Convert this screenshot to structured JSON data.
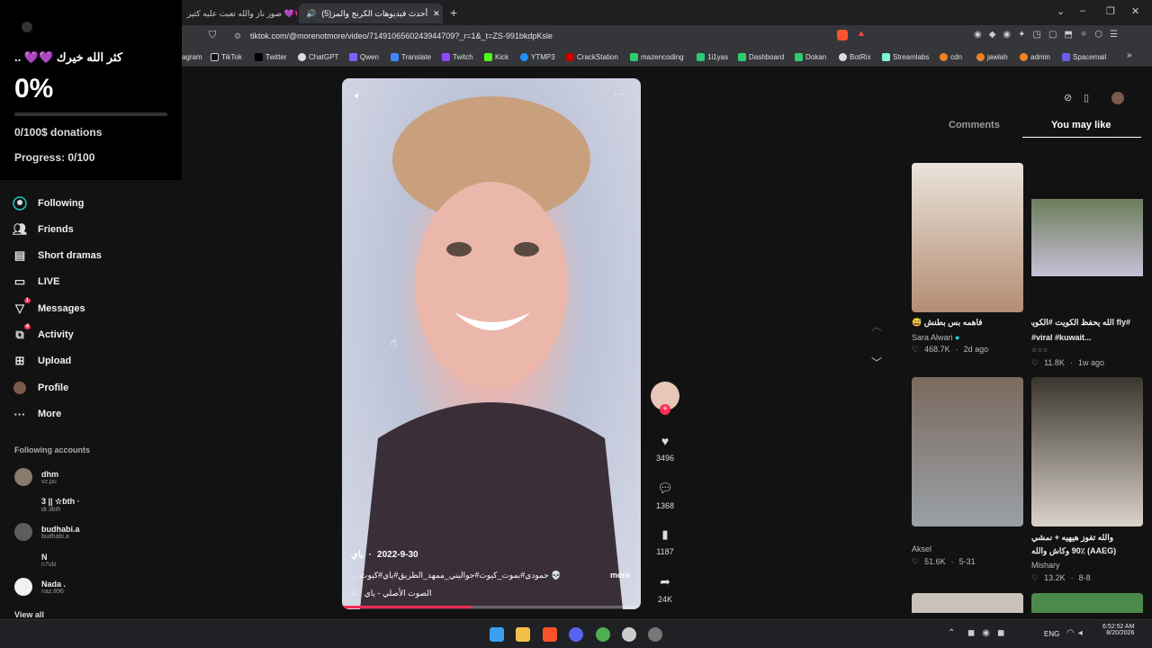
{
  "tabs": [
    {
      "label": "صور ناز والله تعبت عليه كثير 💜💗💗"
    },
    {
      "label": "(5)أحدث فيديوهات الكرنج والمز"
    }
  ],
  "address_bar": {
    "url": "tiktok.com/@morenotmore/video/7149106560243944709?_r=1&_t=ZS-991bkdpKsle"
  },
  "bookmarks": [
    "agram",
    "TikTok",
    "Twitter",
    "ChatGPT",
    "Qwen",
    "Translate",
    "Twitch",
    "Kick",
    "YTMP3",
    "CrackStation",
    "mazencoding",
    "1i1yas",
    "Dashboard",
    "Dokan",
    "BotRix",
    "Streamlabs",
    "cdn",
    "jawlah",
    "admin",
    "Spacemail"
  ],
  "donation_overlay": {
    "title": "كثر الله خيرك 💜💜 ..",
    "percent": "0%",
    "progress_fraction": 0,
    "donations": "0/100$ donations",
    "progress": "Progress: 0/100"
  },
  "sidebar": {
    "items": [
      {
        "label": "Following",
        "icon": "following-icon"
      },
      {
        "label": "Friends",
        "icon": "friends-icon"
      },
      {
        "label": "Short dramas",
        "icon": "short-dramas-icon"
      },
      {
        "label": "LIVE",
        "icon": "live-icon"
      },
      {
        "label": "Messages",
        "icon": "messages-icon",
        "badge": "1"
      },
      {
        "label": "Activity",
        "icon": "activity-icon",
        "badge": "4"
      },
      {
        "label": "Upload",
        "icon": "upload-icon"
      },
      {
        "label": "Profile",
        "icon": "profile-icon"
      },
      {
        "label": "More",
        "icon": "more-icon"
      }
    ],
    "following_heading": "Following accounts",
    "accounts": [
      {
        "name": "dhm",
        "handle": "vz.pu"
      },
      {
        "name": "3 || ☆ɓth ·",
        "handle": "dr.3bth"
      },
      {
        "name": "budhabi.a",
        "handle": "budhabi.a"
      },
      {
        "name": "N",
        "handle": "n7ulz"
      },
      {
        "name": "Nada .",
        "handle": "naz.896"
      }
    ],
    "view_all": "View all"
  },
  "video": {
    "author": "ياي",
    "date": "2022-9-30",
    "caption": "💀 حمودي#بموت_كيوت#جواليني_ممهد_الطريق#ياي#كيوت ...",
    "more": "more",
    "sound": "الصوت الأصلي - ياي",
    "likes": "3496",
    "comments": "1368",
    "saves": "1187",
    "shares": "24K"
  },
  "right_panel": {
    "tab_comments": "Comments",
    "tab_you_may_like": "You may like",
    "cards": [
      {
        "title": "فاهمه بس بطنش 😅",
        "author": "Sara Alwari",
        "likes": "468.7K",
        "time": "2d ago",
        "colors": [
          "#e9e3da",
          "#b58d74"
        ]
      },
      {
        "title": "#fly الله يحفظ الكويت #الكويت",
        "subtitle": "#viral #kuwait...",
        "author": "☆☆☆",
        "likes": "11.8K",
        "time": "1w ago",
        "colors": [
          "#6c7d5b",
          "#c8c0d8"
        ]
      },
      {
        "title": "",
        "author": "Aksel",
        "likes": "51.6K",
        "time": "5-31",
        "colors": [
          "#7a6a5e",
          "#9aa0a6"
        ]
      },
      {
        "title": "والله تفوز هيهيه + نمشي",
        "subtitle": "(AAEG) 90٪ وكاش والله",
        "author": "Mishary",
        "likes": "13.2K",
        "time": "8-8",
        "colors": [
          "#3b3530",
          "#d9d3cb"
        ]
      }
    ]
  },
  "taskbar": {
    "lang": "ENG",
    "time": "6:52:52 AM",
    "date": "8/20/2026"
  },
  "accent_color": "#fe2c55"
}
